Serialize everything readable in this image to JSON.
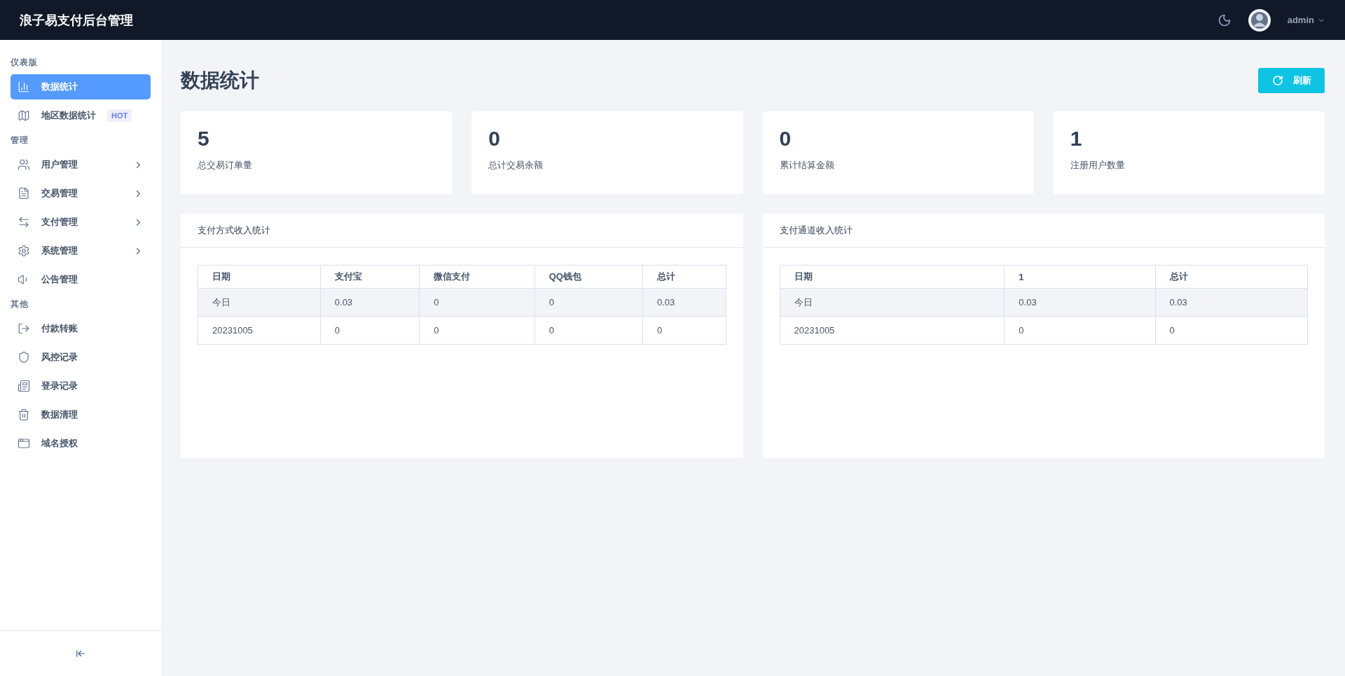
{
  "header": {
    "title": "浪子易支付后台管理",
    "user": "admin"
  },
  "sidebar": {
    "sections": [
      {
        "title": "仪表版",
        "items": [
          {
            "label": "数据统计",
            "selected": true,
            "submenu": false
          },
          {
            "label": "地区数据统计",
            "selected": false,
            "submenu": false,
            "badge": "HOT"
          }
        ]
      },
      {
        "title": "管理",
        "items": [
          {
            "label": "用户管理",
            "selected": false,
            "submenu": true
          },
          {
            "label": "交易管理",
            "selected": false,
            "submenu": true
          },
          {
            "label": "支付管理",
            "selected": false,
            "submenu": true
          },
          {
            "label": "系统管理",
            "selected": false,
            "submenu": true
          },
          {
            "label": "公告管理",
            "selected": false,
            "submenu": false
          }
        ]
      },
      {
        "title": "其他",
        "items": [
          {
            "label": "付款转账",
            "selected": false,
            "submenu": false
          },
          {
            "label": "风控记录",
            "selected": false,
            "submenu": false
          },
          {
            "label": "登录记录",
            "selected": false,
            "submenu": false
          },
          {
            "label": "数据清理",
            "selected": false,
            "submenu": false
          },
          {
            "label": "域名授权",
            "selected": false,
            "submenu": false
          }
        ]
      }
    ]
  },
  "page": {
    "title": "数据统计",
    "refresh_button": "刷新"
  },
  "stats": [
    {
      "value": "5",
      "label": "总交易订单量"
    },
    {
      "value": "0",
      "label": "总计交易余额"
    },
    {
      "value": "0",
      "label": "累计结算金额"
    },
    {
      "value": "1",
      "label": "注册用户数量"
    }
  ],
  "panels": [
    {
      "title": "支付方式收入统计",
      "table": {
        "columns": [
          "日期",
          "支付宝",
          "微信支付",
          "QQ钱包",
          "总计"
        ],
        "rows": [
          [
            "今日",
            "0.03",
            "0",
            "0",
            "0.03"
          ],
          [
            "20231005",
            "0",
            "0",
            "0",
            "0"
          ]
        ]
      }
    },
    {
      "title": "支付通道收入统计",
      "table": {
        "columns": [
          "日期",
          "1",
          "总计"
        ],
        "rows": [
          [
            "今日",
            "0.03",
            "0.03"
          ],
          [
            "20231005",
            "0",
            "0"
          ]
        ]
      }
    }
  ]
}
